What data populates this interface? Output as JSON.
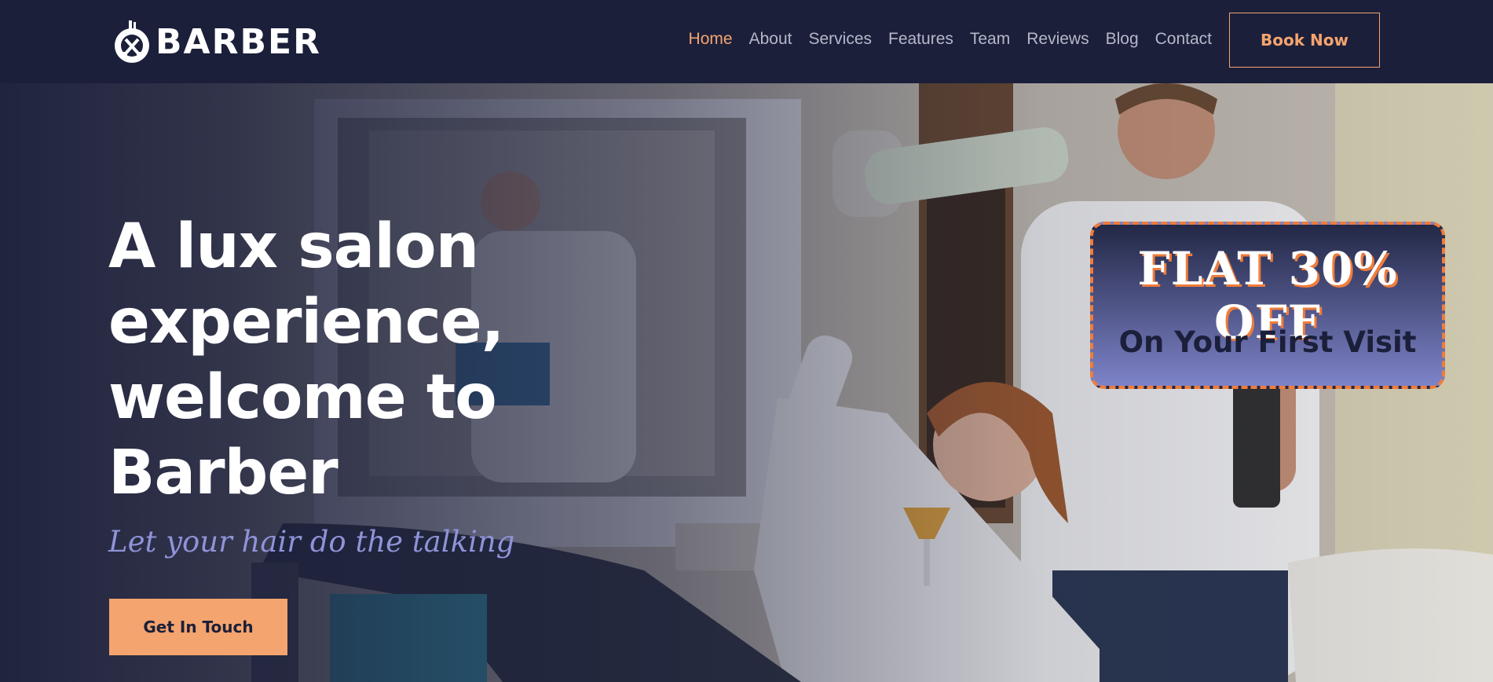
{
  "brand": {
    "name": "BARBER",
    "logo_icon": "scissors-comb-icon"
  },
  "nav": {
    "items": [
      {
        "label": "Home",
        "active": true
      },
      {
        "label": "About",
        "active": false
      },
      {
        "label": "Services",
        "active": false
      },
      {
        "label": "Features",
        "active": false
      },
      {
        "label": "Team",
        "active": false
      },
      {
        "label": "Reviews",
        "active": false
      },
      {
        "label": "Blog",
        "active": false
      },
      {
        "label": "Contact",
        "active": false
      }
    ],
    "book_label": "Book Now"
  },
  "hero": {
    "headline": "A lux salon experience, welcome to Barber",
    "tagline": "Let your hair do the talking",
    "cta_label": "Get In Touch",
    "background_image": "salon-photo"
  },
  "promo": {
    "title": "FLAT 30% OFF",
    "subtitle": "On Your First Visit"
  },
  "colors": {
    "navy": "#1b1f3a",
    "accent": "#f4a46e",
    "tagline": "#8f93d8",
    "promo_border": "#ef7c3b",
    "nav_text": "#b4b8c9"
  }
}
